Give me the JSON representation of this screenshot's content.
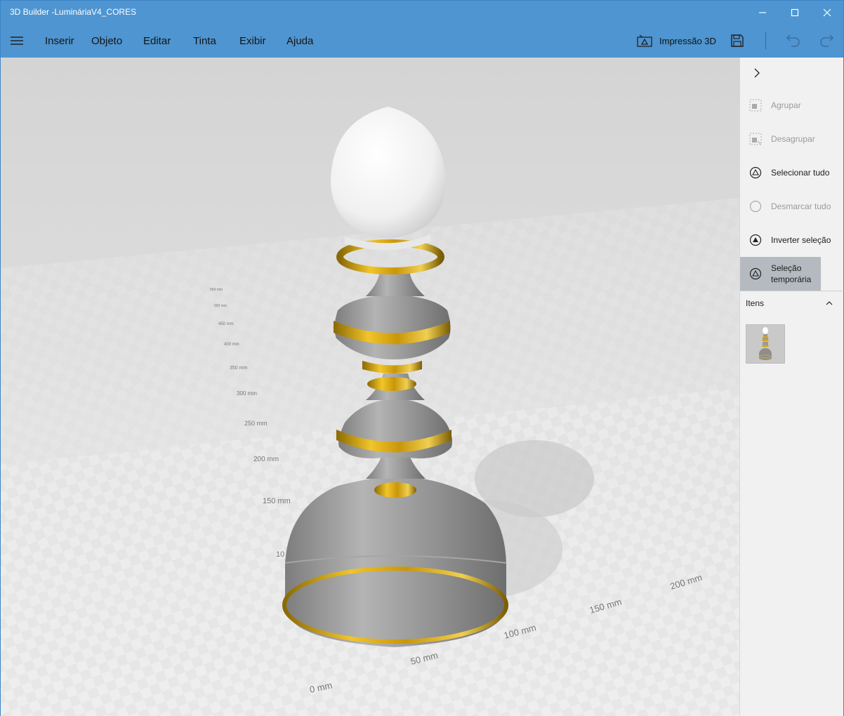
{
  "window": {
    "title": "3D Builder -LumináriaV4_CORES",
    "colors": {
      "titlebar": "#4e95d1",
      "viewport": "#dcdcdc",
      "gold": "#d9a80f",
      "gray_body": "#9e9e9e"
    }
  },
  "menu": {
    "hamburger_icon": "hamburger-menu-icon",
    "items": [
      {
        "label": "Inserir"
      },
      {
        "label": "Objeto"
      },
      {
        "label": "Editar"
      },
      {
        "label": "Tinta"
      },
      {
        "label": "Exibir"
      },
      {
        "label": "Ajuda"
      }
    ],
    "print3d_label": "Impressão 3D",
    "icons": [
      "print-3d-icon",
      "save-icon",
      "undo-icon",
      "redo-icon"
    ]
  },
  "viewport": {
    "ruler_x_labels": [
      "0 mm",
      "50 mm",
      "100 mm",
      "150 mm",
      "200 mm"
    ],
    "ruler_y_labels": [
      "150 mm",
      "200 mm",
      "250 mm",
      "300 mm",
      "350 mm",
      "400 mm",
      "450 mm",
      "500 mm",
      "550 mm"
    ],
    "partial_labels": [
      "50",
      "10"
    ]
  },
  "panel": {
    "commands": [
      {
        "label": "Agrupar",
        "enabled": false,
        "icon": "group-icon"
      },
      {
        "label": "Desagrupar",
        "enabled": false,
        "icon": "ungroup-icon"
      },
      {
        "label": "Selecionar tudo",
        "enabled": true,
        "icon": "select-all-icon"
      },
      {
        "label": "Desmarcar tudo",
        "enabled": false,
        "icon": "deselect-all-icon"
      },
      {
        "label": "Inverter seleção",
        "enabled": true,
        "icon": "invert-selection-icon"
      },
      {
        "label_line1": "Seleção",
        "label_line2": "temporária",
        "enabled": true,
        "active": true,
        "icon": "temporary-selection-icon"
      }
    ],
    "items_title": "Itens"
  }
}
